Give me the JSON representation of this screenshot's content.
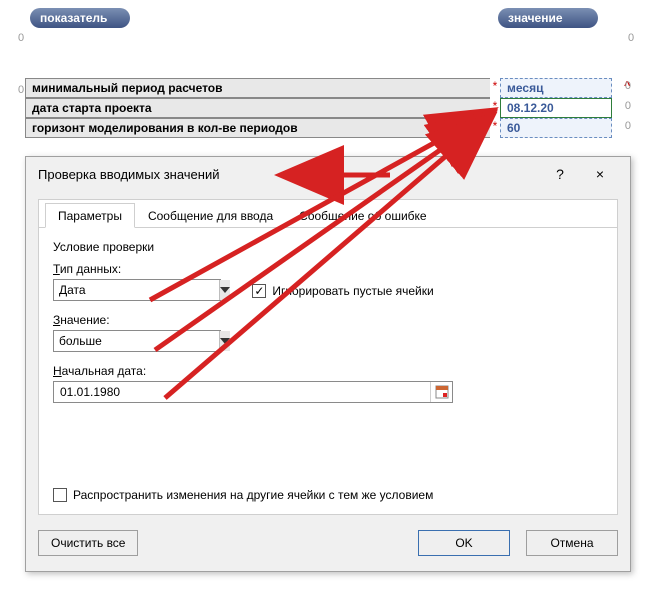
{
  "headers": {
    "left": "показатель",
    "right": "значение"
  },
  "zeros": {
    "tl": "0",
    "tr": "0",
    "ml": "0"
  },
  "caret": "^",
  "rows": [
    {
      "label": "минимальный период расчетов",
      "ast": "*",
      "value": "месяц",
      "tail": "0"
    },
    {
      "label": "дата старта проекта",
      "ast": "*",
      "value": "08.12.20",
      "tail": "0"
    },
    {
      "label": "горизонт моделирования в кол-ве периодов",
      "ast": "*",
      "value": "60",
      "tail": "0"
    }
  ],
  "dialog": {
    "title": "Проверка вводимых значений",
    "help": "?",
    "close": "×",
    "tabs": {
      "t1": "Параметры",
      "t2": "Сообщение для ввода",
      "t3": "Сообщение об ошибке"
    },
    "group": "Условие проверки",
    "labels": {
      "dtype_pre": "Т",
      "dtype_rest": "ип данных:",
      "value_pre": "З",
      "value_rest": "начение:",
      "start_pre": "Н",
      "start_rest": "ачальная дата:",
      "ignore_pre": "И",
      "ignore_rest": "гнорировать пустые ячейки",
      "propagate_pre": "Р",
      "propagate_rest": "аспространить изменения на другие ячейки с тем же условием"
    },
    "values": {
      "dtype": "Дата",
      "comparison": "больше",
      "start_date": "01.01.1980"
    },
    "buttons": {
      "clear": "Очистить все",
      "ok": "OK",
      "cancel": "Отмена"
    }
  }
}
